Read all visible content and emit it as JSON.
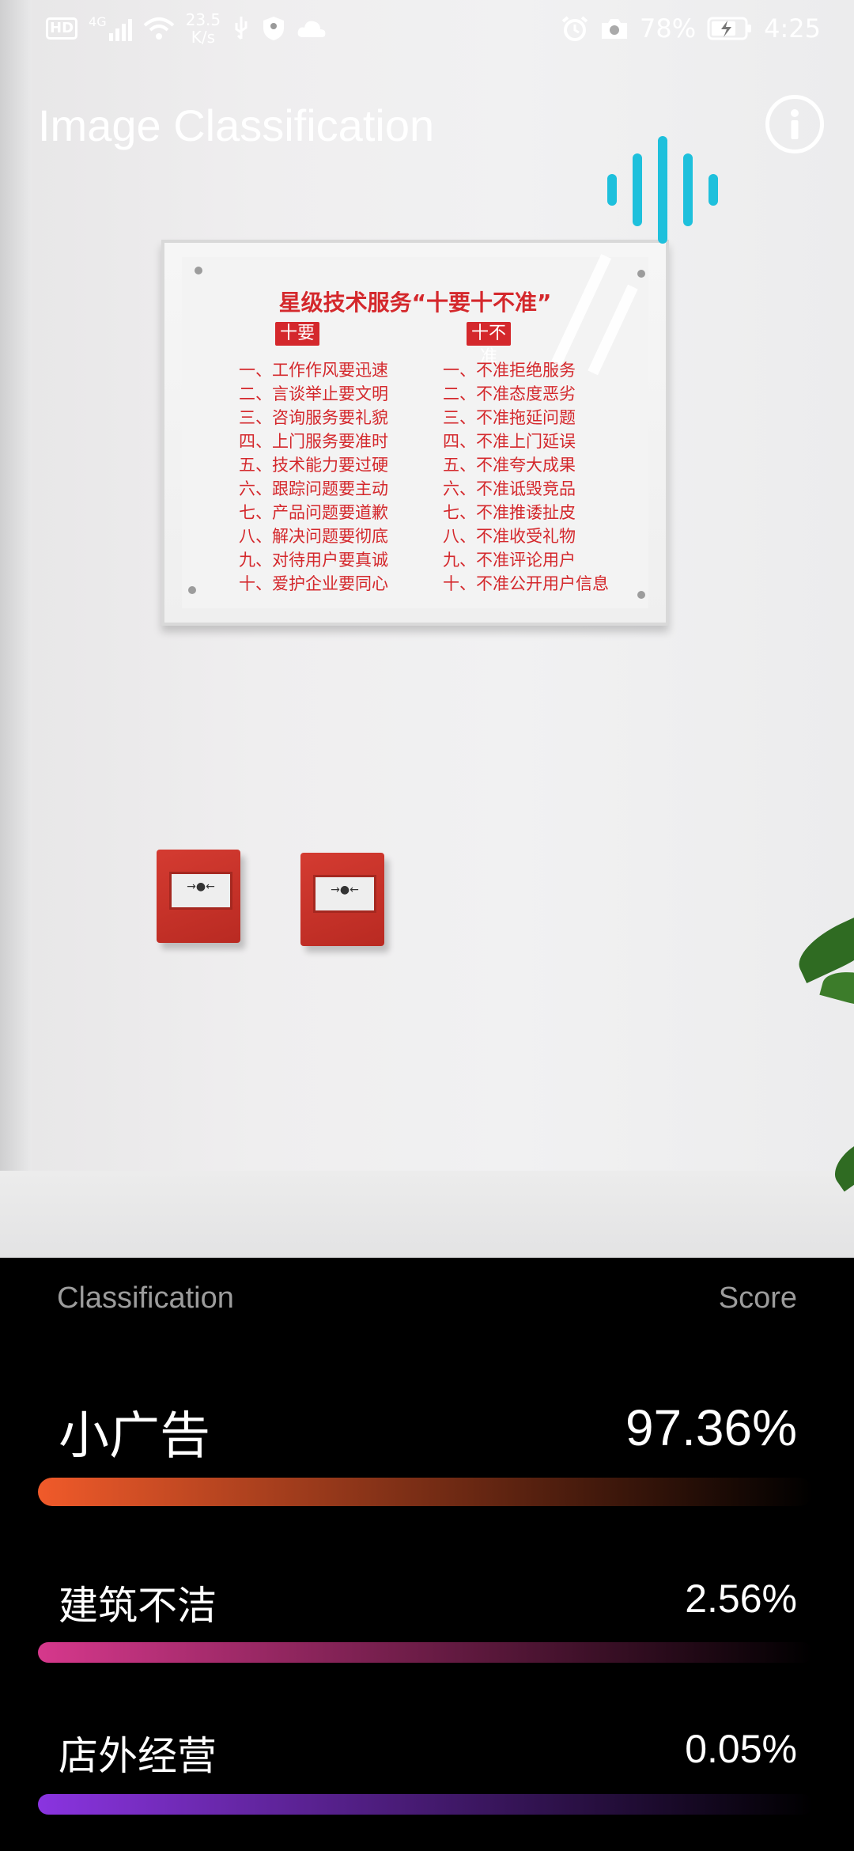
{
  "status_bar": {
    "network": "HD",
    "signal_type": "4G",
    "speed_value": "23.5",
    "speed_unit": "K/s",
    "battery": "78%",
    "time": "4:25"
  },
  "app": {
    "title": "Image Classification"
  },
  "camera": {
    "plaque": {
      "title": "星级技术服务“十要十不准”",
      "tag_left": "十要",
      "tag_right": "十不准",
      "left_items": [
        "一、工作作风要迅速",
        "二、言谈举止要文明",
        "三、咨询服务要礼貌",
        "四、上门服务要准时",
        "五、技术能力要过硬",
        "六、跟踪问题要主动",
        "七、产品问题要道歉",
        "八、解决问题要彻底",
        "九、对待用户要真诚",
        "十、爱护企业要同心"
      ],
      "right_items": [
        "一、不准拒绝服务",
        "二、不准态度恶劣",
        "三、不准拖延问题",
        "四、不准上门延误",
        "五、不准夸大成果",
        "六、不准诋毁竞品",
        "七、不准推诿扯皮",
        "八、不准收受礼物",
        "九、不准评论用户",
        "十、不准公开用户信息"
      ]
    }
  },
  "results": {
    "header_classification": "Classification",
    "header_score": "Score",
    "items": [
      {
        "label": "小广告",
        "score": "97.36%",
        "probability": 0.9736,
        "color": "#f05a2a"
      },
      {
        "label": "建筑不洁",
        "score": "2.56%",
        "probability": 0.0256,
        "color": "#d6388c"
      },
      {
        "label": "店外经营",
        "score": "0.05%",
        "probability": 0.0005,
        "color": "#8a34e0"
      }
    ]
  },
  "colors": {
    "accent_audio": "#1ec0dc",
    "panel_bg": "#000000"
  },
  "icons": [
    "info-icon",
    "audio-wave-icon",
    "signal-icon",
    "wifi-icon",
    "usb-icon",
    "shield-icon",
    "cloud-icon",
    "alarm-icon",
    "camera-icon",
    "battery-icon"
  ]
}
